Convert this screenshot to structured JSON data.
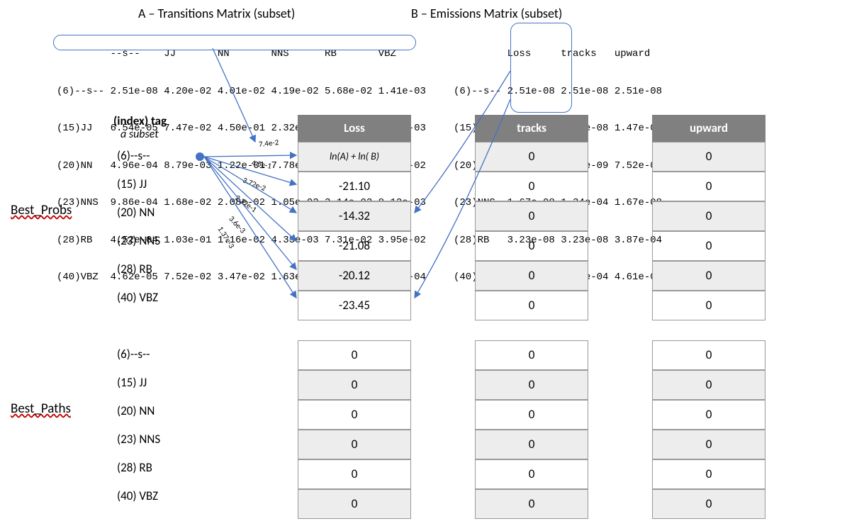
{
  "titles": {
    "A": "A – Transitions Matrix (subset)",
    "B": "B – Emissions Matrix (subset)"
  },
  "matrixA": {
    "header": "         --s--    JJ       NN       NNS      RB       VBZ",
    "rows": [
      "(6)--s-- 2.51e-08 4.20e-02 4.01e-02 4.19e-02 5.68e-02 1.41e-03",
      "(15)JJ   6.54e-05 7.47e-02 4.50e-01 2.32e-01 3.64e-03 1.37e-03",
      "(20)NN   4.96e-04 8.79e-03 1.22e-01 7.78e-02 1.83e-02 4.37e-02",
      "(23)NNS  9.86e-04 1.68e-02 2.08e-02 1.05e-02 3.14e-02 8.12e-03",
      "(28)RB   4.52e-04 1.03e-01 1.16e-02 4.33e-03 7.31e-02 3.95e-02",
      "(40)VBZ  4.62e-05 7.52e-02 3.47e-02 1.63e-02 1.35e-01 9.23e-04"
    ]
  },
  "matrixB": {
    "header": "         Loss     tracks   upward",
    "rows": [
      "(6)--s-- 2.51e-08 2.51e-08 2.51e-08",
      "(15)JJ   1.63e-08 1.63e-08 1.47e-04",
      "(20)NN   1.50e-05 7.52e-09 7.52e-09",
      "(23)NNS  1.67e-08 1.34e-04 1.67e-08",
      "(28)RB   3.23e-08 3.23e-08 3.87e-04",
      "(40)VBZ  4.61e-08 4.61e-04 4.61e-08"
    ]
  },
  "index_header": "(index) tag",
  "subset_label": "a subset",
  "row_tags": [
    "(6)--s--",
    "(15) JJ",
    "(20) NN",
    "(23) NNS",
    "(28) RB",
    "(40) VBZ"
  ],
  "columns": {
    "loss": "Loss",
    "tracks": "tracks",
    "upward": "upward"
  },
  "probs": {
    "label": "Best_Probs",
    "loss": [
      "ln(A) + ln( B)",
      "-21.10",
      "-14.32",
      "-21.08",
      "-20.12",
      "-23.45"
    ],
    "tracks": [
      "0",
      "0",
      "0",
      "0",
      "0",
      "0"
    ],
    "upward": [
      "0",
      "0",
      "0",
      "0",
      "0",
      "0"
    ]
  },
  "paths": {
    "label": "Best_Paths",
    "loss": [
      "0",
      "0",
      "0",
      "0",
      "0",
      "0"
    ],
    "tracks": [
      "0",
      "0",
      "0",
      "0",
      "0",
      "0"
    ],
    "upward": [
      "0",
      "0",
      "0",
      "0",
      "0",
      "0"
    ]
  },
  "edge_labels": [
    "7.4e-2",
    "4.5e-1",
    "3.72e-2",
    "2.32e-1",
    "3.6e-3",
    "1.37e-3"
  ]
}
